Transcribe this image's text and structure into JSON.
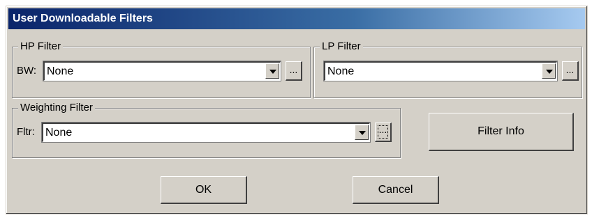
{
  "window": {
    "title": "User Downloadable Filters"
  },
  "hp_filter": {
    "legend": "HP Filter",
    "label": "BW:",
    "value": "None",
    "browse_label": "..."
  },
  "lp_filter": {
    "legend": "LP Filter",
    "value": "None",
    "browse_label": "..."
  },
  "weighting_filter": {
    "legend": "Weighting Filter",
    "label": "Fltr:",
    "value": "None",
    "browse_label": "..."
  },
  "buttons": {
    "filter_info": "Filter Info",
    "ok": "OK",
    "cancel": "Cancel"
  },
  "colors": {
    "face": "#d4d0c8",
    "title_start": "#0a246a",
    "title_end": "#a6caf0"
  }
}
